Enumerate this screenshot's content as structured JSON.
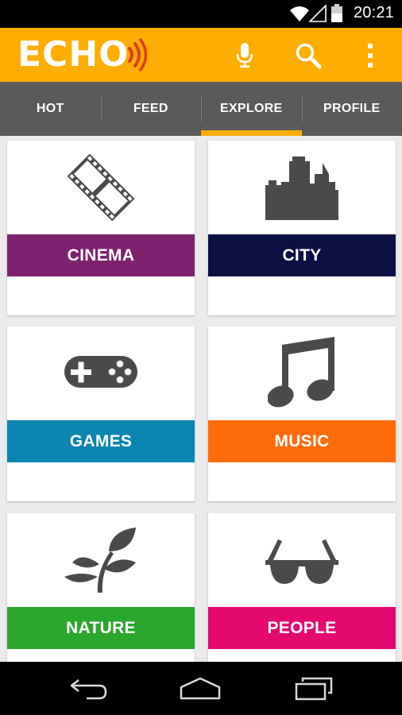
{
  "status_bar": {
    "time": "20:21",
    "icons": [
      "wifi-icon",
      "signal-icon",
      "battery-icon"
    ]
  },
  "app_bar": {
    "logo_text": "ECHO",
    "background_color": "#ffad00",
    "logo_accent_color": "#e23b1b",
    "actions": [
      "microphone-icon",
      "search-icon",
      "overflow-menu-icon"
    ]
  },
  "tabs": {
    "items": [
      {
        "label": "HOT"
      },
      {
        "label": "FEED"
      },
      {
        "label": "EXPLORE"
      },
      {
        "label": "PROFILE"
      }
    ],
    "active": "EXPLORE",
    "background_color": "#5a5a5a",
    "indicator_color": "#ffad00"
  },
  "categories": [
    {
      "label": "CINEMA",
      "color": "#7d216f",
      "icon": "film-strip-icon"
    },
    {
      "label": "CITY",
      "color": "#0c1045",
      "icon": "city-skyline-icon"
    },
    {
      "label": "GAMES",
      "color": "#0a85b1",
      "icon": "gamepad-icon"
    },
    {
      "label": "MUSIC",
      "color": "#ff6b08",
      "icon": "music-note-icon"
    },
    {
      "label": "NATURE",
      "color": "#2ba62d",
      "icon": "plant-icon"
    },
    {
      "label": "PEOPLE",
      "color": "#e3096f",
      "icon": "sunglasses-icon"
    }
  ],
  "nav_bar": {
    "buttons": [
      "back-icon",
      "home-icon",
      "recent-apps-icon"
    ]
  }
}
